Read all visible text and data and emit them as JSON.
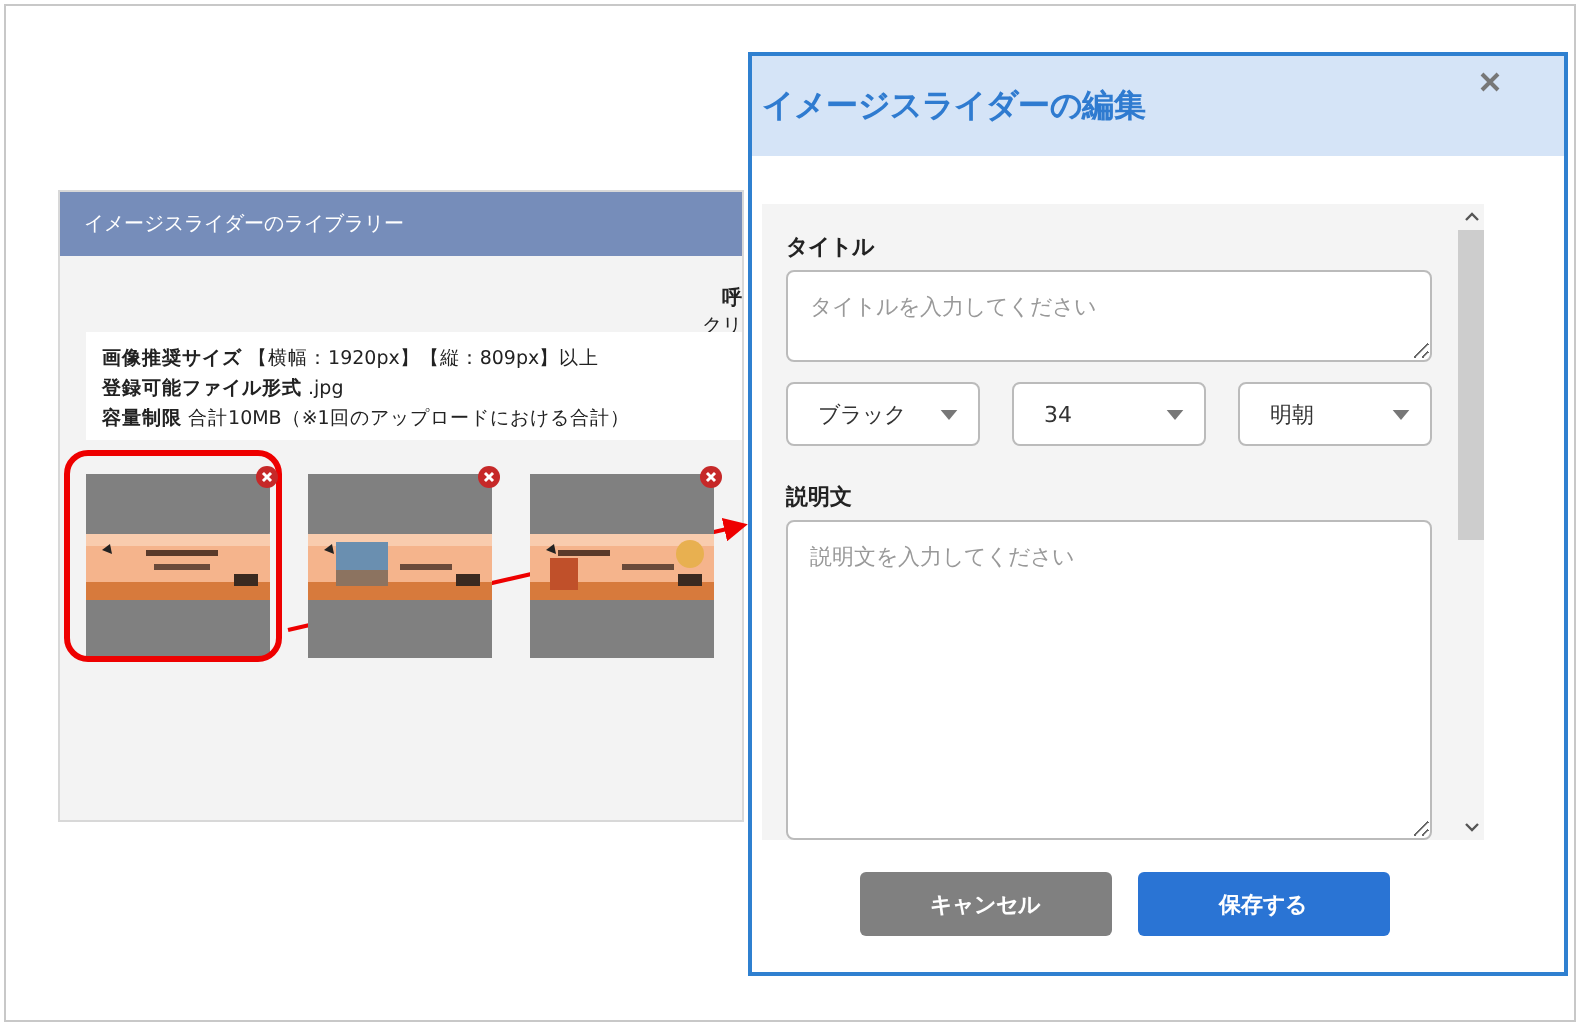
{
  "library": {
    "title": "イメージスライダーのライブラリー",
    "cut_heading": "呼",
    "cut_text": "クリ",
    "specs": [
      "**画像推奨サイズ** 【横幅：1920px】【縦：809px】以上",
      "**登録可能ファイル形式** .jpg",
      "**容量制限** 合計10MB（※1回のアップロードにおける合計）"
    ],
    "images": [
      {
        "kind": "picture",
        "highlighted": true
      },
      {
        "kind": "picture",
        "highlighted": false
      },
      {
        "kind": "picture",
        "highlighted": false
      }
    ]
  },
  "dialog": {
    "title": "イメージスライダーの編集",
    "title_label": "タイトル",
    "title_placeholder": "タイトルを入力してください",
    "selects": [
      {
        "value": "ブラック"
      },
      {
        "value": "34"
      },
      {
        "value": "明朝"
      }
    ],
    "description_label": "説明文",
    "description_placeholder": "説明文を入力してください",
    "buttons": [
      {
        "kind": "cancel",
        "label": "キャンセル"
      },
      {
        "kind": "save",
        "label": "保存する"
      }
    ]
  }
}
